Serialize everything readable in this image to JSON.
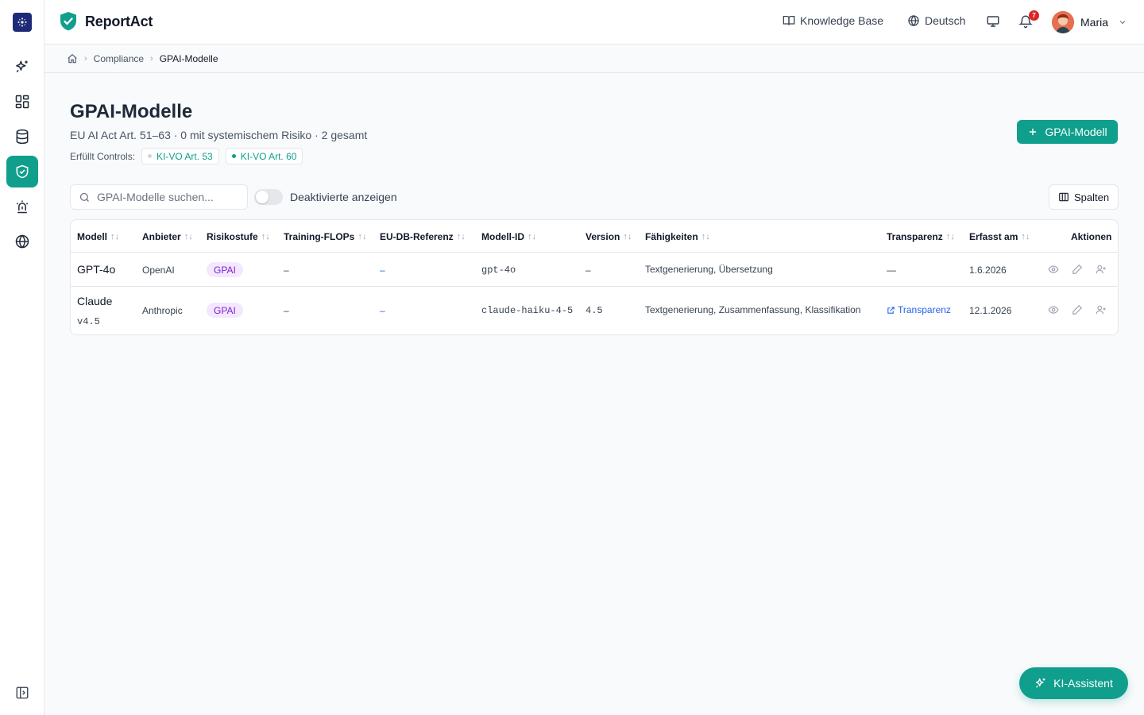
{
  "app": {
    "name": "ReportAct"
  },
  "header": {
    "knowledge_base": "Knowledge Base",
    "language": "Deutsch",
    "notification_count": "7",
    "user_name": "Maria"
  },
  "breadcrumb": {
    "items": [
      "Compliance",
      "GPAI-Modelle"
    ]
  },
  "page": {
    "title": "GPAI-Modelle",
    "subtitle": "EU AI Act Art. 51–63 · 0 mit systemischem Risiko · 2 gesamt",
    "controls_label": "Erfüllt Controls:",
    "controls": [
      {
        "label": "KI-VO Art. 53",
        "dot_color": "#d1d5db"
      },
      {
        "label": "KI-VO Art. 60",
        "dot_color": "#0f9f8c"
      }
    ],
    "add_button": "GPAI-Modell"
  },
  "toolbar": {
    "search_placeholder": "GPAI-Modelle suchen...",
    "toggle_label": "Deaktivierte anzeigen",
    "columns_button": "Spalten"
  },
  "table": {
    "headers": {
      "model": "Modell",
      "provider": "Anbieter",
      "risk": "Risikostufe",
      "flops": "Training-FLOPs",
      "eudb": "EU-DB-Referenz",
      "model_id": "Modell-ID",
      "version": "Version",
      "capabilities": "Fähigkeiten",
      "transparency": "Transparenz",
      "created": "Erfasst am",
      "actions": "Aktionen"
    },
    "rows": [
      {
        "model": "GPT-4o",
        "model_version": "",
        "provider": "OpenAI",
        "risk": "GPAI",
        "flops": "–",
        "eudb": "–",
        "model_id": "gpt-4o",
        "version": "–",
        "capabilities": "Textgenerierung, Übersetzung",
        "transparency": "—",
        "created": "1.6.2026"
      },
      {
        "model": "Claude",
        "model_version": "v4.5",
        "provider": "Anthropic",
        "risk": "GPAI",
        "flops": "–",
        "eudb": "–",
        "model_id": "claude-haiku-4-5",
        "version": "4.5",
        "capabilities": "Textgenerierung, Zusammenfassung, Klassifikation",
        "transparency": "Transparenz",
        "created": "12.1.2026"
      }
    ]
  },
  "assistant": {
    "label": "KI-Assistent"
  },
  "colors": {
    "accent": "#0f9f8c",
    "badge_bg": "#f3e8ff",
    "badge_text": "#7e22ce",
    "link": "#2563eb"
  }
}
